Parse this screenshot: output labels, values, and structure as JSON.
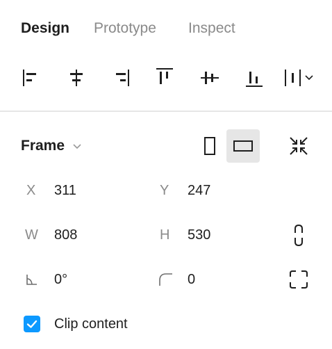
{
  "tabs": [
    {
      "label": "Design",
      "active": true
    },
    {
      "label": "Prototype",
      "active": false
    },
    {
      "label": "Inspect",
      "active": false
    }
  ],
  "alignment_tools": [
    "align-left-icon",
    "align-horizontal-center-icon",
    "align-right-icon",
    "align-top-icon",
    "align-vertical-center-icon",
    "align-bottom-icon",
    "distribute-spacing-icon"
  ],
  "frame": {
    "title": "Frame",
    "orientation": "landscape",
    "x_label": "X",
    "x_value": "311",
    "y_label": "Y",
    "y_value": "247",
    "w_label": "W",
    "w_value": "808",
    "h_label": "H",
    "h_value": "530",
    "rotation_value": "0°",
    "radius_value": "0",
    "clip_content_label": "Clip content",
    "clip_content_checked": true
  },
  "colors": {
    "accent": "#0d99ff",
    "text": "#1e1e1e",
    "muted": "#8a8a8a",
    "selected_bg": "#e6e6e6"
  }
}
